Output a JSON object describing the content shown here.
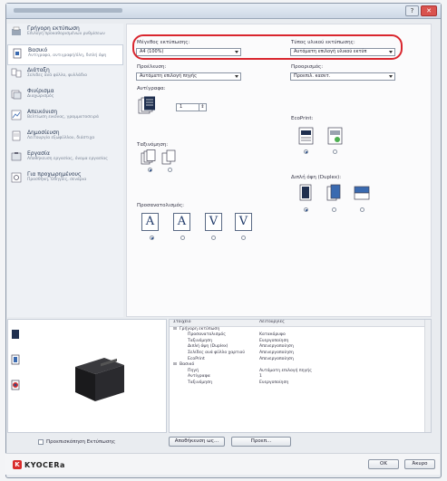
{
  "sidebar": {
    "items": [
      {
        "title": "Γρήγορη εκτύπωση",
        "sub": "Επιλογή προκαθορισμένων ρυθμίσεων"
      },
      {
        "title": "Βασικό",
        "sub": "Αντίγραφα, αντιγραφή/όλη, διπλή όψη"
      },
      {
        "title": "Διάταξη",
        "sub": "Σελίδες ανά φύλλο, φυλλάδιο"
      },
      {
        "title": "Φινίρισμα",
        "sub": "Διαχωρισμός"
      },
      {
        "title": "Απεικόνιση",
        "sub": "Βελτίωση εικόνας, γραμματοσειρά"
      },
      {
        "title": "Δημοσίευση",
        "sub": "Λειτουργία εξωφύλλου, διάστιχα"
      },
      {
        "title": "Εργασία",
        "sub": "Αποθήκευση εργασίας, όνομα εργασίας"
      },
      {
        "title": "Για προχωρημένους",
        "sub": "Προσθήκη, Οδηγίες, σενάρια"
      }
    ]
  },
  "main": {
    "page_size_label": "Μέγεθος εκτύπωσης:",
    "page_size_value": "A4 (100%)",
    "media_type_label": "Τύπος υλικού εκτύπωσης:",
    "media_type_value": "Αυτόματη επιλογή υλικού εκτύπ",
    "source_label": "Προέλευση:",
    "source_value": "Αυτόματη επιλογή πηγής",
    "source2_label": "Προορισμός:",
    "source2_value": "Προεπιλ. κασετ.",
    "copies_label": "Αντίγραφα:",
    "copies_value": "1",
    "collate_label": "Ταξινόμηση:",
    "orientation_label": "Προσανατολισμός:",
    "ecoprint_label": "EcoPrint:",
    "duplex_label": "Διπλή όψη (Duplex):"
  },
  "summary": {
    "header_key": "Στοιχείο",
    "header_val": "Λειτουργίες",
    "rows": [
      {
        "k": "Γρήγορη εκτύπωση",
        "v": "",
        "grp": true
      },
      {
        "k": "Προσανατολισμός",
        "v": "Κατακόρυφο"
      },
      {
        "k": "Ταξινόμηση",
        "v": "Ενεργοποίηση"
      },
      {
        "k": "Διπλή όψη (Duplex)",
        "v": "Απενεργοποίηση"
      },
      {
        "k": "Σελίδες ανά φύλλο χαρτιού",
        "v": "Απενεργοποίηση"
      },
      {
        "k": "EcoPrint",
        "v": "Απενεργοποίηση"
      },
      {
        "k": "Βασικό",
        "v": "",
        "grp": true
      },
      {
        "k": "Πηγή",
        "v": "Αυτόματη επιλογή πηγής"
      },
      {
        "k": "Αντίγραφα",
        "v": "1"
      },
      {
        "k": "Ταξινόμηση",
        "v": "Ενεργοποίηση"
      }
    ]
  },
  "footer": {
    "checkbox_label": "Προεπισκόπηση Εκτύπωσης",
    "save_as_label": "Αποθήκευση ως...",
    "reset_label": "Προεπ...",
    "ok_label": "OK",
    "cancel_label": "Άκυρο",
    "logo_text": "KYOCERa"
  },
  "colors": {
    "highlight": "#d9262e",
    "brand": "#d92b2b"
  }
}
